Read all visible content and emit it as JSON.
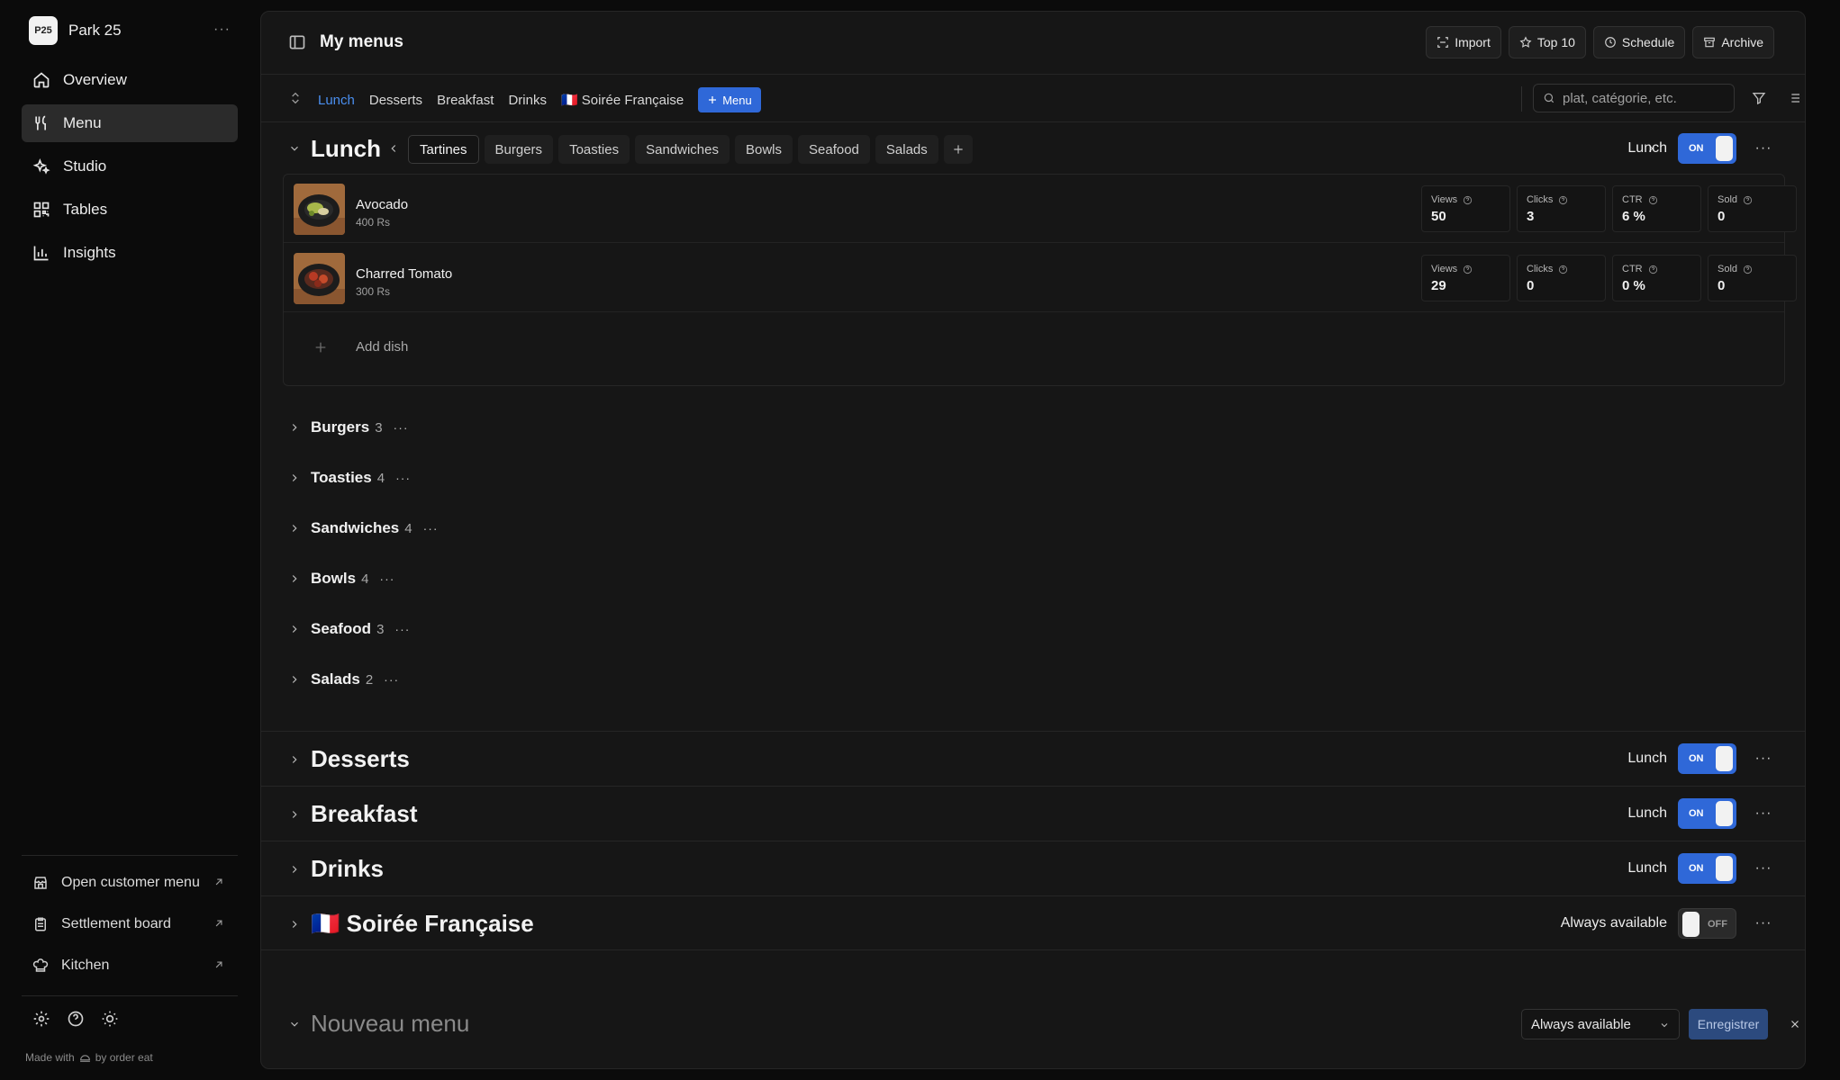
{
  "brand": {
    "name": "Park 25",
    "logo_text": "P25"
  },
  "nav": [
    {
      "label": "Overview",
      "icon": "home-icon"
    },
    {
      "label": "Menu",
      "icon": "utensils-icon",
      "active": true
    },
    {
      "label": "Studio",
      "icon": "sparkles-icon"
    },
    {
      "label": "Tables",
      "icon": "qr-icon"
    },
    {
      "label": "Insights",
      "icon": "chart-icon"
    }
  ],
  "bottom_links": [
    {
      "label": "Open customer menu",
      "icon": "store-icon"
    },
    {
      "label": "Settlement board",
      "icon": "clipboard-icon"
    },
    {
      "label": "Kitchen",
      "icon": "chef-hat-icon"
    }
  ],
  "made_with": {
    "prefix": "Made with",
    "suffix": "by order eat"
  },
  "header": {
    "title": "My menus",
    "actions": [
      {
        "label": "Import",
        "icon": "scan-icon"
      },
      {
        "label": "Top 10",
        "icon": "star-icon"
      },
      {
        "label": "Schedule",
        "icon": "clock-icon"
      },
      {
        "label": "Archive",
        "icon": "archive-icon"
      }
    ]
  },
  "menu_tabs": [
    {
      "label": "Lunch",
      "active": true
    },
    {
      "label": "Desserts"
    },
    {
      "label": "Breakfast"
    },
    {
      "label": "Drinks"
    },
    {
      "label": "🇫🇷 Soirée Française"
    }
  ],
  "add_menu_label": "Menu",
  "search": {
    "placeholder": "plat, catégorie, etc."
  },
  "lunch": {
    "title": "Lunch",
    "availability": "Lunch",
    "toggle": "ON",
    "categories": [
      "Tartines",
      "Burgers",
      "Toasties",
      "Sandwiches",
      "Bowls",
      "Seafood",
      "Salads"
    ],
    "active_category": "Tartines",
    "dishes": [
      {
        "name": "Avocado",
        "price": "400 Rs",
        "views": "50",
        "clicks": "3",
        "ctr": "6 %",
        "sold": "0"
      },
      {
        "name": "Charred Tomato",
        "price": "300 Rs",
        "views": "29",
        "clicks": "0",
        "ctr": "0 %",
        "sold": "0"
      }
    ],
    "stat_labels": {
      "views": "Views",
      "clicks": "Clicks",
      "ctr": "CTR",
      "sold": "Sold"
    },
    "add_dish": "Add dish",
    "collapsed_categories": [
      {
        "name": "Burgers",
        "count": "3"
      },
      {
        "name": "Toasties",
        "count": "4"
      },
      {
        "name": "Sandwiches",
        "count": "4"
      },
      {
        "name": "Bowls",
        "count": "4"
      },
      {
        "name": "Seafood",
        "count": "3"
      },
      {
        "name": "Salads",
        "count": "2"
      }
    ]
  },
  "menus": [
    {
      "title": "Desserts",
      "availability": "Lunch",
      "toggle": "ON"
    },
    {
      "title": "Breakfast",
      "availability": "Lunch",
      "toggle": "ON"
    },
    {
      "title": "Drinks",
      "availability": "Lunch",
      "toggle": "ON"
    },
    {
      "title": "🇫🇷 Soirée Française",
      "availability": "Always available",
      "toggle": "OFF"
    }
  ],
  "new_menu": {
    "title": "Nouveau menu",
    "select_value": "Always available",
    "save_label": "Enregistrer"
  },
  "colors": {
    "accent": "#2f68d8",
    "active_tab": "#4a8ff0",
    "panel": "#161616",
    "background": "#0b0b0b"
  }
}
